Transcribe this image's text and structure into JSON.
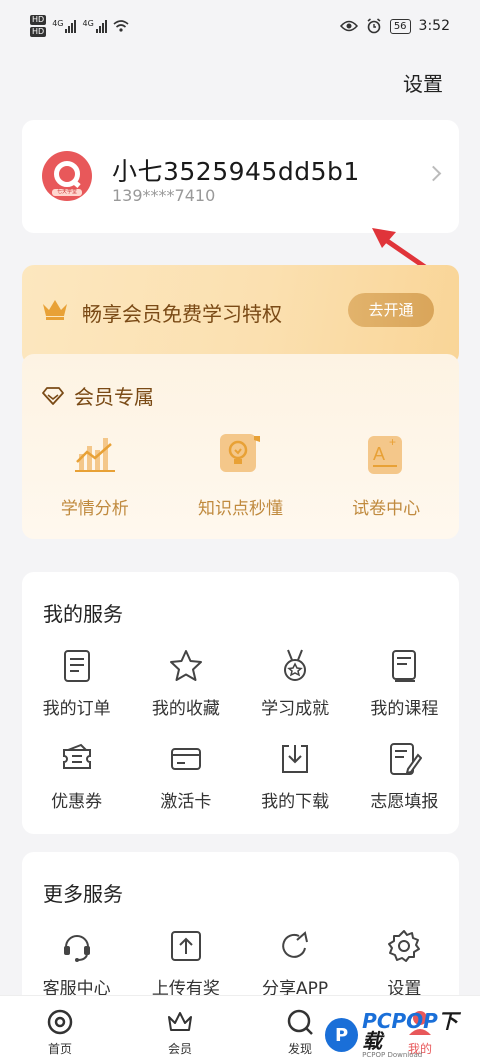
{
  "status_bar": {
    "hd1": "HD",
    "hd2": "HD",
    "net1": "4G",
    "net2": "4G",
    "battery": "56",
    "time": "3:52"
  },
  "header": {
    "settings_label": "设置"
  },
  "profile": {
    "username": "小七3525945dd5b1",
    "phone": "139****7410",
    "avatar_tag": "七天学堂"
  },
  "vip_banner": {
    "text": "畅享会员免费学习特权",
    "button_label": "去开通"
  },
  "vip_exclusive": {
    "title": "会员专属",
    "items": [
      {
        "label": "学情分析",
        "icon": "bar-chart-icon"
      },
      {
        "label": "知识点秒懂",
        "icon": "lightbulb-icon"
      },
      {
        "label": "试卷中心",
        "icon": "exam-paper-icon"
      }
    ]
  },
  "my_services": {
    "title": "我的服务",
    "items": [
      {
        "label": "我的订单",
        "icon": "order-icon"
      },
      {
        "label": "我的收藏",
        "icon": "star-icon"
      },
      {
        "label": "学习成就",
        "icon": "medal-icon"
      },
      {
        "label": "我的课程",
        "icon": "course-icon"
      },
      {
        "label": "优惠券",
        "icon": "coupon-icon"
      },
      {
        "label": "激活卡",
        "icon": "card-icon"
      },
      {
        "label": "我的下载",
        "icon": "download-icon"
      },
      {
        "label": "志愿填报",
        "icon": "form-edit-icon"
      }
    ]
  },
  "more_services": {
    "title": "更多服务",
    "items": [
      {
        "label": "客服中心",
        "icon": "headset-icon"
      },
      {
        "label": "上传有奖",
        "icon": "upload-icon"
      },
      {
        "label": "分享APP",
        "icon": "share-icon"
      },
      {
        "label": "设置",
        "icon": "gear-icon"
      }
    ]
  },
  "tabbar": {
    "tabs": [
      {
        "label": "首页"
      },
      {
        "label": "会员"
      },
      {
        "label": "发现"
      },
      {
        "label": "我的"
      }
    ],
    "active": "我的"
  },
  "watermark": {
    "main_prefix": "PCPOP",
    "main_suffix": "下载",
    "sub": "PCPOP Download"
  },
  "colors": {
    "accent": "#e8585a",
    "vip_brown": "#7a4a16",
    "vip_gold": "#c08a3e",
    "annotation_arrow": "#e0343a"
  }
}
